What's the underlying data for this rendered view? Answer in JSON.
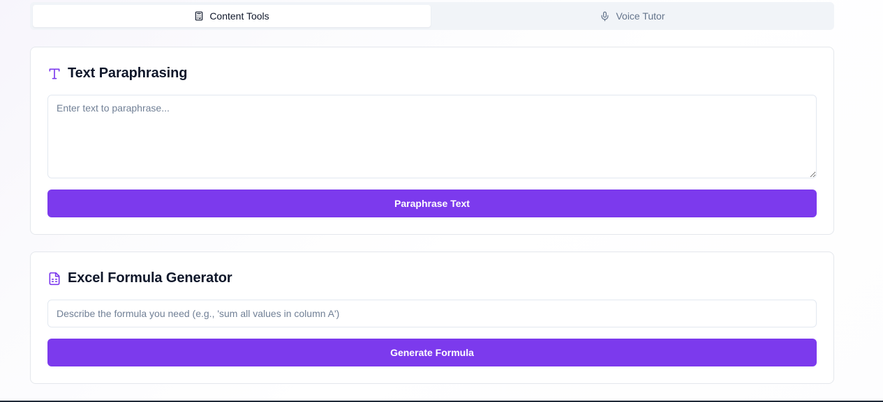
{
  "tabs": [
    {
      "label": "Content Tools",
      "icon": "calculator-icon",
      "active": true
    },
    {
      "label": "Voice Tutor",
      "icon": "microphone-icon",
      "active": false
    }
  ],
  "paraphrase": {
    "title": "Text Paraphrasing",
    "icon": "type-icon",
    "placeholder": "Enter text to paraphrase...",
    "value": "",
    "button_label": "Paraphrase Text"
  },
  "formula": {
    "title": "Excel Formula Generator",
    "icon": "spreadsheet-file-icon",
    "placeholder": "Describe the formula you need (e.g., 'sum all values in column A')",
    "value": "",
    "button_label": "Generate Formula"
  },
  "colors": {
    "accent": "#7c3aed",
    "tab_bar_bg": "#f1f4f8",
    "border": "#e4e7ec"
  }
}
